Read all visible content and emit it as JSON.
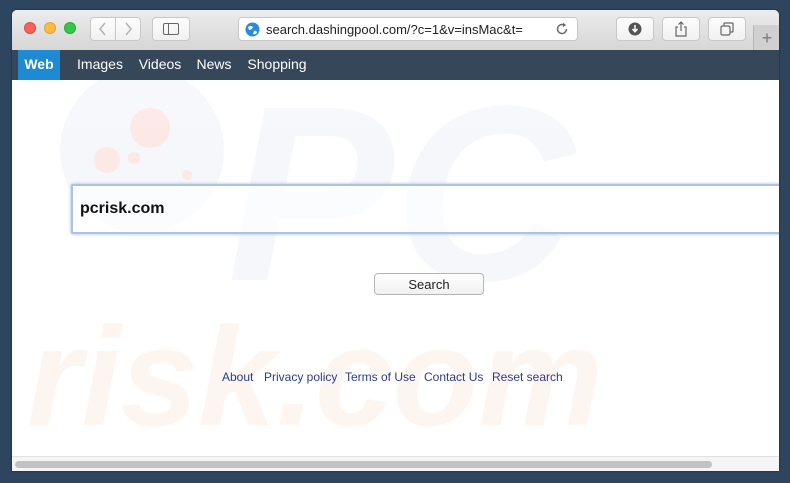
{
  "browser": {
    "url": "search.dashingpool.com/?c=1&v=insMac&t=",
    "new_tab_label": "+"
  },
  "site_nav": {
    "tabs": [
      {
        "label": "Web",
        "active": true
      },
      {
        "label": "Images",
        "active": false
      },
      {
        "label": "Videos",
        "active": false
      },
      {
        "label": "News",
        "active": false
      },
      {
        "label": "Shopping",
        "active": false
      }
    ]
  },
  "search": {
    "value": "pcrisk.com",
    "button_label": "Search"
  },
  "footer": {
    "links": [
      "About",
      "Privacy policy",
      "Terms of Use",
      "Contact Us",
      "Reset search"
    ]
  },
  "watermark": {
    "top_text": "PC",
    "bottom_text": "risk.com"
  },
  "colors": {
    "nav_bar": "#36475a",
    "active_tab": "#1d8ad3",
    "link": "#2a3c8e",
    "input_border": "#a9c4e4"
  }
}
